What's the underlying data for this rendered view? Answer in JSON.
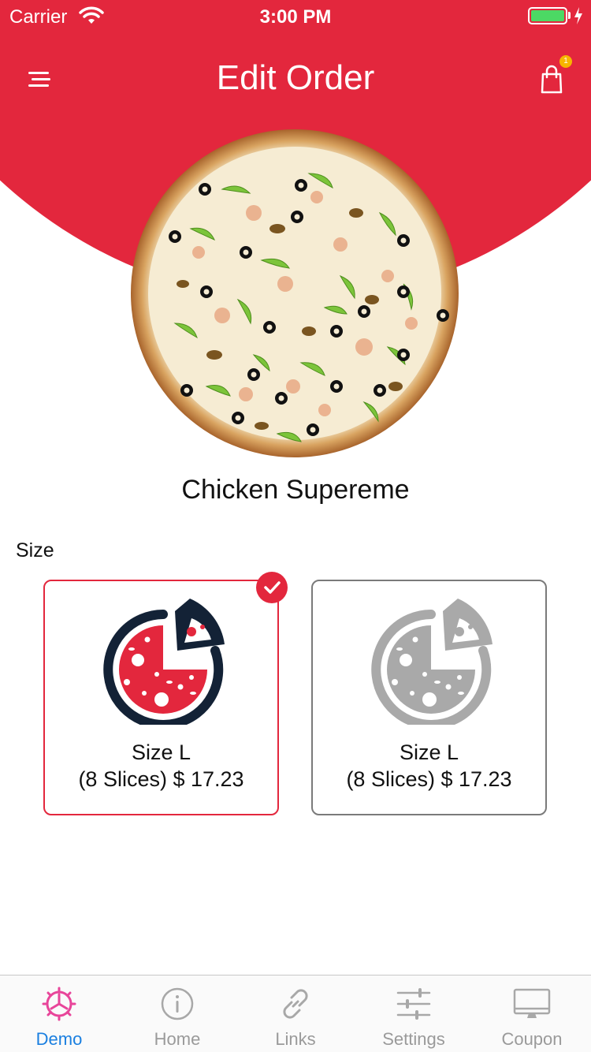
{
  "status_bar": {
    "carrier": "Carrier",
    "time": "3:00 PM"
  },
  "header": {
    "title": "Edit Order",
    "cart_badge": "1",
    "accent_color": "#e3273d"
  },
  "product": {
    "name": "Chicken Supereme"
  },
  "size_section": {
    "label": "Size",
    "options": [
      {
        "size": "Size L",
        "detail": "(8 Slices)  $ 17.23",
        "selected": true
      },
      {
        "size": "Size L",
        "detail": "(8 Slices)  $ 17.23",
        "selected": false
      }
    ]
  },
  "tab_bar": {
    "tabs": [
      {
        "label": "Demo",
        "icon": "gear-icon",
        "active": true
      },
      {
        "label": "Home",
        "icon": "info-icon",
        "active": false
      },
      {
        "label": "Links",
        "icon": "link-icon",
        "active": false
      },
      {
        "label": "Settings",
        "icon": "sliders-icon",
        "active": false
      },
      {
        "label": "Coupon",
        "icon": "monitor-icon",
        "active": false
      }
    ],
    "active_color": "#1a7fe0",
    "inactive_color": "#9a9a9a"
  }
}
